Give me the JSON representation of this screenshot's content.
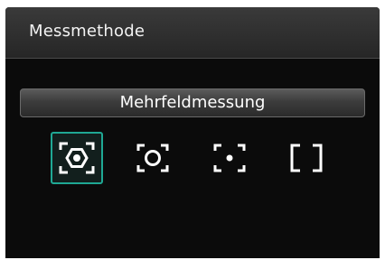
{
  "title": "Messmethode",
  "current_mode": "Mehrfeldmessung",
  "colors": {
    "accent": "#1fa894",
    "background": "#0b0b0b",
    "text": "#ffffff"
  },
  "options": [
    {
      "icon": "evaluative-metering-icon",
      "selected": true
    },
    {
      "icon": "partial-metering-icon",
      "selected": false
    },
    {
      "icon": "spot-metering-icon",
      "selected": false
    },
    {
      "icon": "center-weighted-metering-icon",
      "selected": false
    }
  ]
}
